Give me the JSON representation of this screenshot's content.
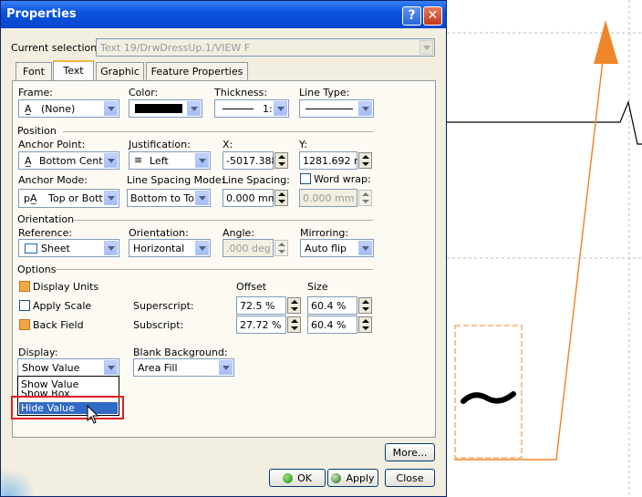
{
  "window": {
    "title": "Properties",
    "help_label": "?",
    "close_label": "✕"
  },
  "selection": {
    "label": "Current selection :",
    "value": "Text 19/DrwDressUp.1/VIEW F"
  },
  "tabs": [
    {
      "label": "Font"
    },
    {
      "label": "Text"
    },
    {
      "label": "Graphic"
    },
    {
      "label": "Feature Properties"
    }
  ],
  "frame": {
    "label": "Frame:",
    "value": "(None)",
    "icon": "frame-text-icon"
  },
  "color": {
    "label": "Color:",
    "value": "#000000"
  },
  "thickness": {
    "label": "Thickness:",
    "value": "1:"
  },
  "line_type": {
    "label": "Line Type:"
  },
  "position": {
    "section": "Position",
    "anchor_point": {
      "label": "Anchor Point:",
      "value": "Bottom Cente"
    },
    "justification": {
      "label": "Justification:",
      "value": "Left"
    },
    "x": {
      "label": "X:",
      "value": "-5017.388"
    },
    "y": {
      "label": "Y:",
      "value": "1281.692 mı"
    },
    "anchor_mode": {
      "label": "Anchor Mode:",
      "value": "Top or Bottc"
    },
    "line_spacing_mode": {
      "label": "Line Spacing Mode:",
      "value": "Bottom to Top"
    },
    "line_spacing": {
      "label": "Line Spacing:",
      "value": "0.000 mm"
    },
    "word_wrap": {
      "label": "Word wrap:",
      "value": "0.000 mm"
    }
  },
  "orientation": {
    "section": "Orientation",
    "reference": {
      "label": "Reference:",
      "value": "Sheet"
    },
    "orientation": {
      "label": "Orientation:",
      "value": "Horizontal"
    },
    "angle": {
      "label": "Angle:",
      "value": ".000 deg"
    },
    "mirroring": {
      "label": "Mirroring:",
      "value": "Auto flip"
    }
  },
  "options": {
    "section": "Options",
    "display_units": "Display Units",
    "apply_scale": "Apply Scale",
    "back_field": "Back Field",
    "offset_header": "Offset",
    "size_header": "Size",
    "superscript": {
      "label": "Superscript:",
      "offset": "72.5 %",
      "size": "60.4 %"
    },
    "subscript": {
      "label": "Subscript:",
      "offset": "27.72 %",
      "size": "60.4 %"
    }
  },
  "display": {
    "label": "Display:",
    "value": "Show Value",
    "options": [
      "Show Value",
      "Show Box",
      "Hide Value"
    ],
    "selected": "Hide Value"
  },
  "blank_background": {
    "label": "Blank Background:",
    "value": "Area Fill"
  },
  "buttons": {
    "more": "More...",
    "ok": "OK",
    "apply": "Apply",
    "close": "Close"
  },
  "colors": {
    "accent_orange": "#f0862a",
    "selection_blue": "#316ac5",
    "highlight_red": "#e02020"
  }
}
